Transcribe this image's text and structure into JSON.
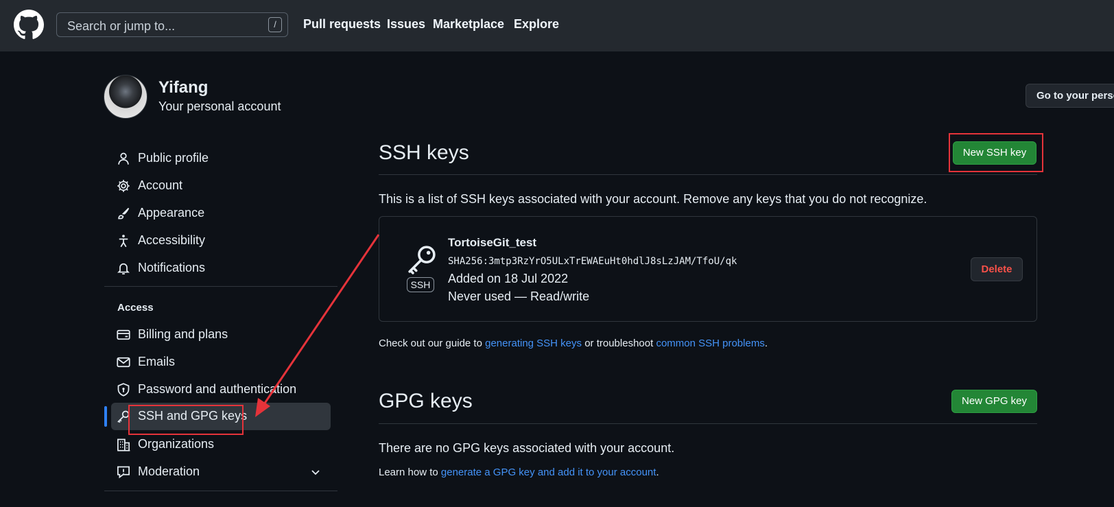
{
  "header": {
    "search_placeholder": "Search or jump to...",
    "search_shortcut": "/",
    "nav": [
      "Pull requests",
      "Issues",
      "Marketplace",
      "Explore"
    ]
  },
  "profile": {
    "name": "Yifang",
    "subtitle": "Your personal account",
    "goto_button": "Go to your perso"
  },
  "sidebar": {
    "items": [
      {
        "label": "Public profile",
        "icon": "person-icon"
      },
      {
        "label": "Account",
        "icon": "gear-icon"
      },
      {
        "label": "Appearance",
        "icon": "paintbrush-icon"
      },
      {
        "label": "Accessibility",
        "icon": "accessibility-icon"
      },
      {
        "label": "Notifications",
        "icon": "bell-icon"
      }
    ],
    "access_heading": "Access",
    "access_items": [
      {
        "label": "Billing and plans",
        "icon": "credit-card-icon"
      },
      {
        "label": "Emails",
        "icon": "mail-icon"
      },
      {
        "label": "Password and authentication",
        "icon": "shield-lock-icon"
      },
      {
        "label": "SSH and GPG keys",
        "icon": "key-icon",
        "active": true
      },
      {
        "label": "Organizations",
        "icon": "organization-icon"
      },
      {
        "label": "Moderation",
        "icon": "report-icon"
      }
    ]
  },
  "ssh": {
    "title": "SSH keys",
    "new_button": "New SSH key",
    "description": "This is a list of SSH keys associated with your account. Remove any keys that you do not recognize.",
    "key": {
      "badge": "SSH",
      "title": "TortoiseGit_test",
      "fingerprint": "SHA256:3mtp3RzYrO5ULxTrEWAEuHt0hdlJ8sLzJAM/TfoU/qk",
      "added": "Added on 18 Jul 2022",
      "usage": "Never used — Read/write",
      "delete_button": "Delete"
    },
    "guide": {
      "prefix": "Check out our guide to ",
      "link1": "generating SSH keys",
      "middle": " or troubleshoot ",
      "link2": "common SSH problems",
      "suffix": "."
    }
  },
  "gpg": {
    "title": "GPG keys",
    "new_button": "New GPG key",
    "empty_text": "There are no GPG keys associated with your account.",
    "learn": {
      "prefix": "Learn how to ",
      "link": "generate a GPG key and add it to your account",
      "suffix": "."
    }
  },
  "colors": {
    "background": "#0d1117",
    "header": "#24292f",
    "green_button": "#238636",
    "link": "#4493f8",
    "danger": "#f85149",
    "annotation_red": "#e5333a"
  }
}
